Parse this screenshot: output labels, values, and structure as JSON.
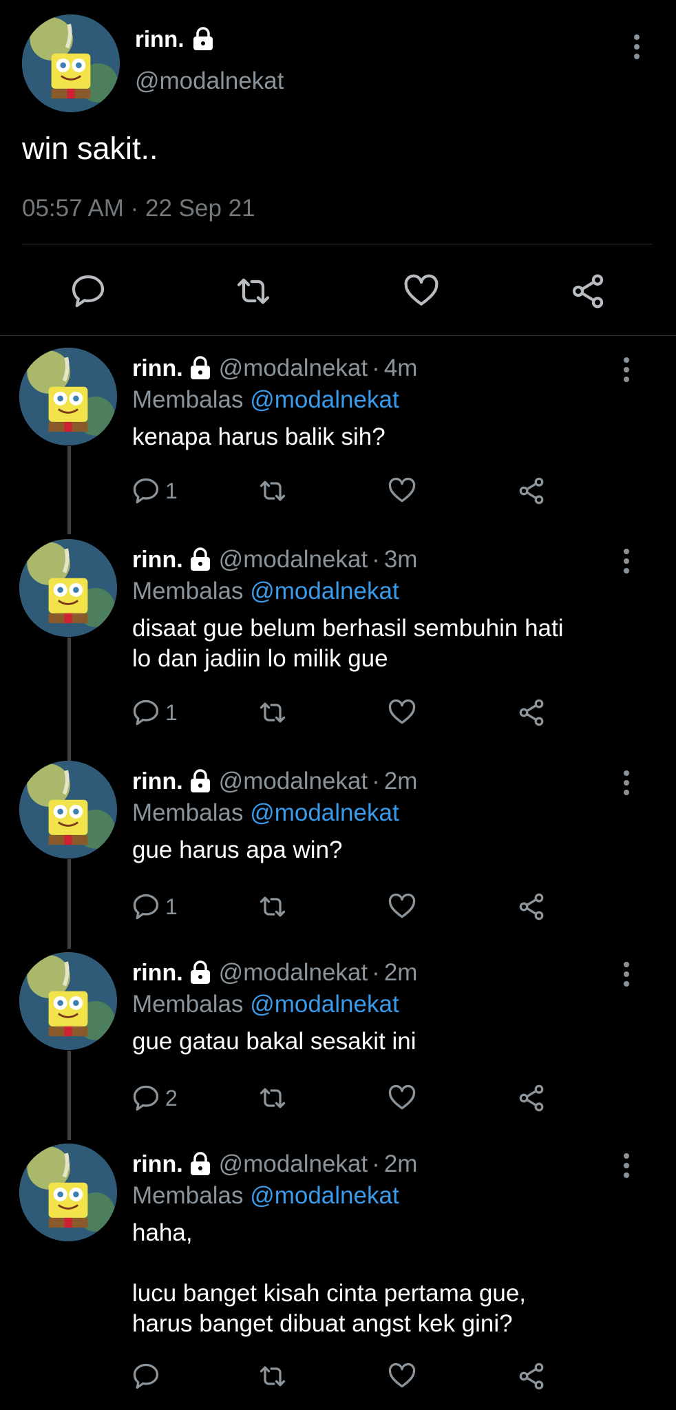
{
  "main_tweet": {
    "name": "rinn.",
    "handle": "@modalnekat",
    "text": "win sakit..",
    "timestamp": "05:57 AM · 22 Sep 21"
  },
  "replies": [
    {
      "name": "rinn.",
      "handle": "@modalnekat",
      "time": "4m",
      "replying_prefix": "Membalas",
      "replying_to": "@modalnekat",
      "text_lines": [
        "kenapa harus balik sih?"
      ],
      "reply_count": "1"
    },
    {
      "name": "rinn.",
      "handle": "@modalnekat",
      "time": "3m",
      "replying_prefix": "Membalas",
      "replying_to": "@modalnekat",
      "text_lines": [
        "disaat gue belum berhasil sembuhin hati",
        "lo dan jadiin lo milik gue"
      ],
      "reply_count": "1"
    },
    {
      "name": "rinn.",
      "handle": "@modalnekat",
      "time": "2m",
      "replying_prefix": "Membalas",
      "replying_to": "@modalnekat",
      "text_lines": [
        "gue harus apa win?"
      ],
      "reply_count": "1"
    },
    {
      "name": "rinn.",
      "handle": "@modalnekat",
      "time": "2m",
      "replying_prefix": "Membalas",
      "replying_to": "@modalnekat",
      "text_lines": [
        "gue gatau bakal sesakit ini"
      ],
      "reply_count": "2"
    },
    {
      "name": "rinn.",
      "handle": "@modalnekat",
      "time": "2m",
      "replying_prefix": "Membalas",
      "replying_to": "@modalnekat",
      "text_lines": [
        "haha,",
        "",
        "lucu banget kisah cinta pertama gue,",
        "harus banget dibuat angst kek gini?"
      ],
      "reply_count": ""
    }
  ],
  "colors": {
    "background": "#000000",
    "text_primary": "#ffffff",
    "text_secondary": "#8b949b",
    "mention": "#3a9bea",
    "divider": "#2f3336",
    "thread_line": "#3d4145"
  },
  "icons": [
    "lock-icon",
    "more-icon",
    "reply-icon",
    "retweet-icon",
    "like-icon",
    "share-icon"
  ]
}
